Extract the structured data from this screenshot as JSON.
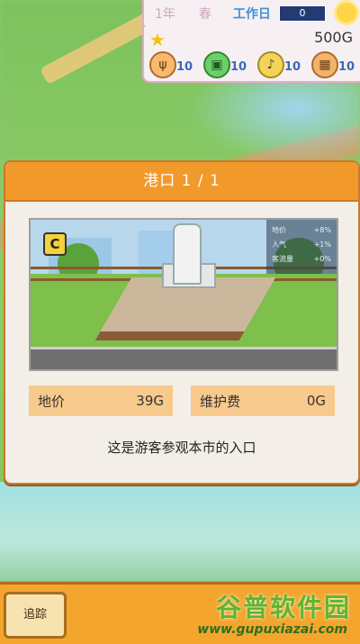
{
  "hud": {
    "year": "1年",
    "season": "春",
    "day_type": "工作日",
    "moon_value": "0",
    "money": "500G",
    "stats": [
      {
        "icon": "fork-knife-icon",
        "value": "10"
      },
      {
        "icon": "bag-icon",
        "value": "10"
      },
      {
        "icon": "music-note-icon",
        "value": "10"
      },
      {
        "icon": "frame-icon",
        "value": "10"
      }
    ]
  },
  "dialog": {
    "title": "港口 1 / 1",
    "badge": "C",
    "overlay": [
      {
        "label": "地价",
        "value": "+8%"
      },
      {
        "label": "人气",
        "value": "+1%"
      },
      {
        "label": "客流量",
        "value": "+0%"
      }
    ],
    "land_price_label": "地价",
    "land_price_value": "39G",
    "maintenance_label": "维护费",
    "maintenance_value": "0G",
    "description": "这是游客参观本市的入口"
  },
  "bottom": {
    "track_label": "追踪",
    "watermark_title": "谷普软件园",
    "watermark_url": "www.gupuxiazai.com"
  }
}
